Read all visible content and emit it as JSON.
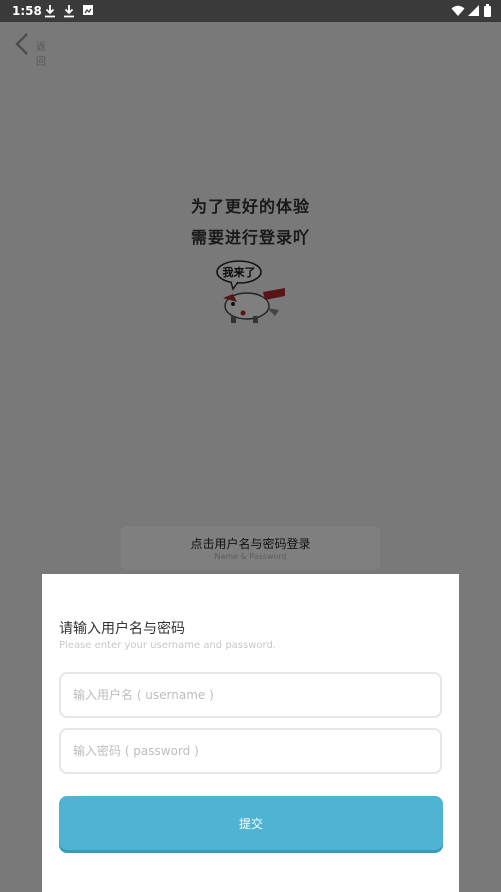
{
  "status_bar": {
    "time": "1:58",
    "left_icons": [
      "download-icon",
      "download-icon",
      "image-icon"
    ],
    "right_icons": [
      "wifi-icon",
      "signal-icon",
      "battery-icon"
    ]
  },
  "header": {
    "back_label": "返回"
  },
  "page": {
    "headline_line1": "为了更好的体验",
    "headline_line2": "需要进行登录吖",
    "mascot_bubble_text": "我来了"
  },
  "login_entry": {
    "label": "点击用户名与密码登录",
    "sub_label": "Name & Password"
  },
  "sheet": {
    "title": "请输入用户名与密码",
    "subtitle": "Please enter your username and password.",
    "username_placeholder": "输入用户名 ( username )",
    "username_value": "",
    "password_placeholder": "输入密码 ( password )",
    "password_value": "",
    "submit_label": "提交"
  },
  "colors": {
    "accent": "#4fb4d3",
    "overlay": "rgba(0,0,0,0.5)",
    "status_bar": "#3a3a3a"
  }
}
